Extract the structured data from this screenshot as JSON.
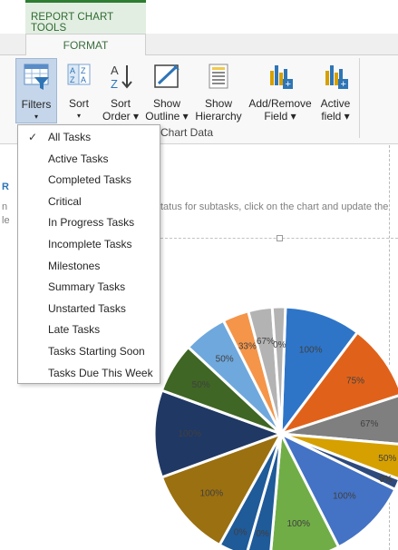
{
  "ribbon": {
    "tool_group_title": "REPORT CHART TOOLS",
    "active_tab": "FORMAT",
    "group_label": "Chart Data",
    "buttons": [
      {
        "name": "filters",
        "line1": "Filters",
        "line2": "▾",
        "icon": "filter-icon"
      },
      {
        "name": "sort",
        "line1": "Sort",
        "line2": "▾",
        "icon": "sort-icon"
      },
      {
        "name": "sort-order",
        "line1": "Sort",
        "line2": "Order ▾",
        "icon": "sort-order-icon"
      },
      {
        "name": "show-outline",
        "line1": "Show",
        "line2": "Outline ▾",
        "icon": "outline-icon"
      },
      {
        "name": "show-hierarchy",
        "line1": "Show",
        "line2": "Hierarchy",
        "icon": "hierarchy-icon"
      },
      {
        "name": "add-remove-field",
        "line1": "Add/Remove",
        "line2": "Field ▾",
        "icon": "add-field-icon"
      },
      {
        "name": "active-field",
        "line1": "Active",
        "line2": "field ▾",
        "icon": "active-field-icon"
      }
    ]
  },
  "filters_menu": {
    "selected": "All Tasks",
    "items": [
      "All Tasks",
      "Active Tasks",
      "Completed Tasks",
      "Critical",
      "In Progress Tasks",
      "Incomplete Tasks",
      "Milestones",
      "Summary Tasks",
      "Unstarted Tasks",
      "Late Tasks",
      "Tasks Starting Soon",
      "Tasks Due This Week"
    ]
  },
  "report": {
    "title_fragment": "R",
    "left_fragment_1": "n",
    "left_fragment_2": "le",
    "status_fragment": "tatus for subtasks, click on the chart and update the"
  },
  "chart_data": {
    "type": "pie",
    "slices": [
      {
        "label": "100%",
        "color": "#2e75c8"
      },
      {
        "label": "75%",
        "color": "#e0621a"
      },
      {
        "label": "67%",
        "color": "#7f7f7f"
      },
      {
        "label": "50%",
        "color": "#d6a000"
      },
      {
        "label": "0%",
        "color": "#2e4a7d"
      },
      {
        "label": "100%",
        "color": "#4472c4"
      },
      {
        "label": "100%",
        "color": "#70ad47"
      },
      {
        "label": "0%",
        "color": "#1f5a99"
      },
      {
        "label": "0%",
        "color": "#1f5a99"
      },
      {
        "label": "100%",
        "color": "#9b7010"
      },
      {
        "label": "100%",
        "color": "#203864"
      },
      {
        "label": "50%",
        "color": "#3f6624"
      },
      {
        "label": "50%",
        "color": "#6fa8dc"
      },
      {
        "label": "33%",
        "color": "#f4954a"
      },
      {
        "label": "67%",
        "color": "#b3b3b3"
      },
      {
        "label": "0%",
        "color": "#b3b3b3"
      }
    ]
  }
}
